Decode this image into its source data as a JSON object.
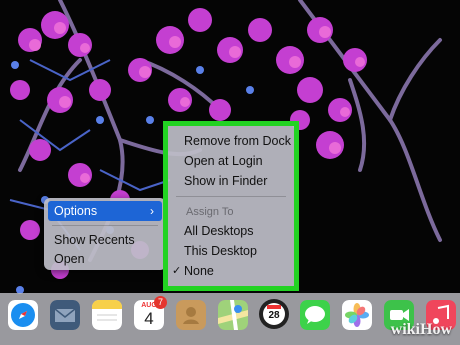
{
  "context_menu": {
    "options_label": "Options",
    "options_chevron": "›",
    "show_recents": "Show Recents",
    "open": "Open"
  },
  "options_submenu": {
    "remove_from_dock": "Remove from Dock",
    "open_at_login": "Open at Login",
    "show_in_finder": "Show in Finder",
    "assign_to_header": "Assign To",
    "all_desktops": "All Desktops",
    "this_desktop": "This Desktop",
    "none": "None",
    "checkmark": "✓",
    "highlight_color": "#22d322"
  },
  "dock": {
    "apps": [
      {
        "icon": "safari-icon"
      },
      {
        "icon": "mail-icon"
      },
      {
        "icon": "notes-icon"
      },
      {
        "icon": "calendar-icon",
        "month": "AUG",
        "day": "4",
        "badge": "7"
      },
      {
        "icon": "contacts-icon"
      },
      {
        "icon": "maps-icon"
      },
      {
        "icon": "calendar-icon",
        "day": "28"
      },
      {
        "icon": "messages-icon"
      },
      {
        "icon": "photos-icon"
      },
      {
        "icon": "facetime-icon"
      },
      {
        "icon": "music-icon"
      }
    ]
  },
  "watermark": "wikiHow"
}
